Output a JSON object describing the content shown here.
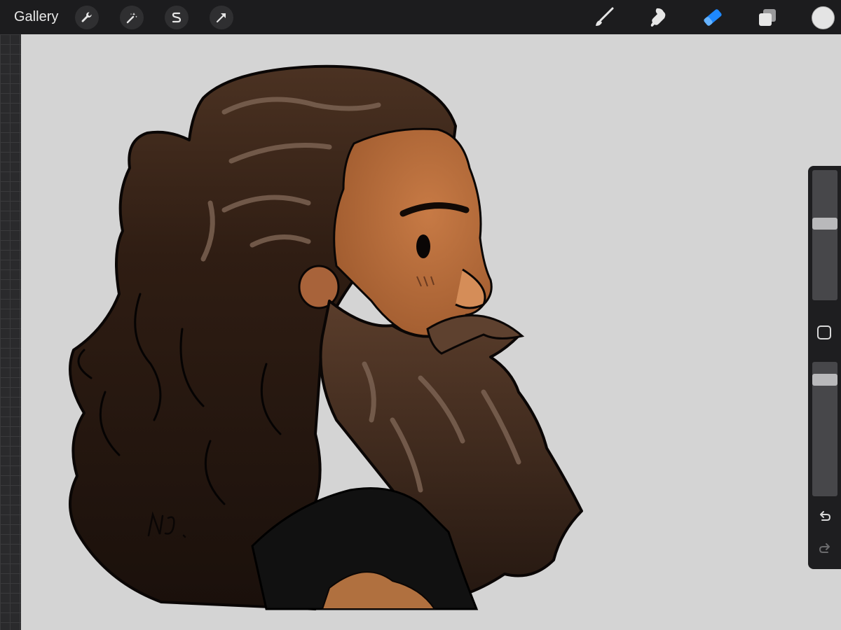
{
  "topbar": {
    "gallery_label": "Gallery",
    "actions": [
      {
        "icon": "wrench-icon"
      },
      {
        "icon": "magic-wand-icon"
      },
      {
        "icon": "selection-s-icon"
      },
      {
        "icon": "arrow-transform-icon"
      }
    ],
    "tools": [
      {
        "icon": "brush-icon",
        "active": false
      },
      {
        "icon": "smudge-icon",
        "active": false
      },
      {
        "icon": "eraser-icon",
        "active": true
      },
      {
        "icon": "layers-icon",
        "active": false
      }
    ],
    "current_color": "#e4e4e4",
    "active_tool_color": "#1e88ff"
  },
  "canvas": {
    "background_color": "#d4d4d4",
    "artwork": "illustration-portrait-bearded-man",
    "signature": "NJ."
  },
  "sidebar": {
    "brush_size_level": 0.6,
    "opacity_level": 0.9,
    "icons": [
      "modify-square-icon",
      "undo-icon",
      "redo-icon"
    ]
  }
}
